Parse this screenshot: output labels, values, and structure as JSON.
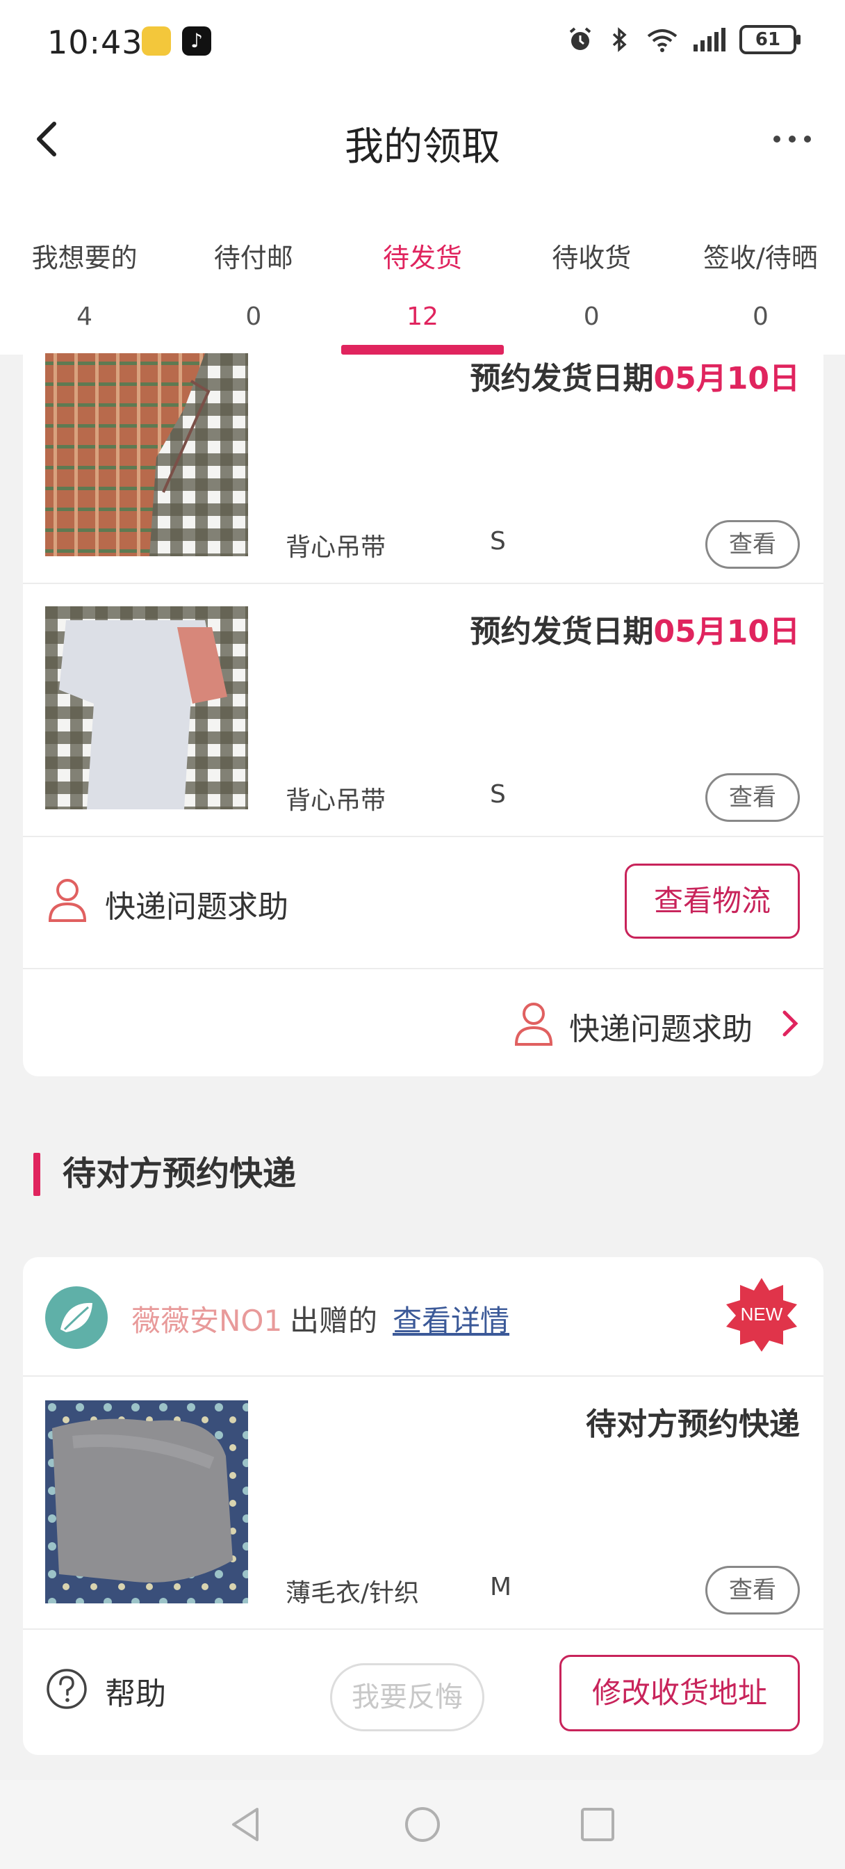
{
  "status_bar": {
    "time": "10:43",
    "battery": "61",
    "icons": [
      "rabbit-app-icon",
      "tiktok-icon",
      "alarm-icon",
      "bluetooth-icon",
      "wifi-icon",
      "signal-icon",
      "battery-icon"
    ]
  },
  "header": {
    "title": "我的领取",
    "back_icon": "chevron-left-icon",
    "more_icon": "more-dots-icon"
  },
  "tabs": [
    {
      "label": "我想要的",
      "count": "4"
    },
    {
      "label": "待付邮",
      "count": "0"
    },
    {
      "label": "待发货",
      "count": "12",
      "active": true
    },
    {
      "label": "待收货",
      "count": "0"
    },
    {
      "label": "签收/待晒",
      "count": "0"
    }
  ],
  "shipment_card": {
    "items": [
      {
        "ship_label": "预约发货日期",
        "ship_date": "05月10日",
        "name": "背心吊带",
        "size": "S",
        "view_label": "查看"
      },
      {
        "ship_label": "预约发货日期",
        "ship_date": "05月10日",
        "name": "背心吊带",
        "size": "S",
        "view_label": "查看"
      }
    ],
    "help_text": "快递问题求助",
    "track_label": "查看物流",
    "help_link_text": "快递问题求助"
  },
  "section": {
    "title": "待对方预约快递"
  },
  "pending_card": {
    "donor_name": "薇薇安NO1",
    "donor_action": "出赠的",
    "details_link": "查看详情",
    "badge": "NEW",
    "item": {
      "status": "待对方预约快递",
      "name": "薄毛衣/针织",
      "size": "M",
      "view_label": "查看"
    },
    "help_label": "帮助",
    "regret_label": "我要反悔",
    "address_label": "修改收货地址"
  },
  "colors": {
    "accent": "#e0245e",
    "button_border": "#c8235a",
    "link": "#3b5998",
    "donor": "#e89a9a"
  }
}
